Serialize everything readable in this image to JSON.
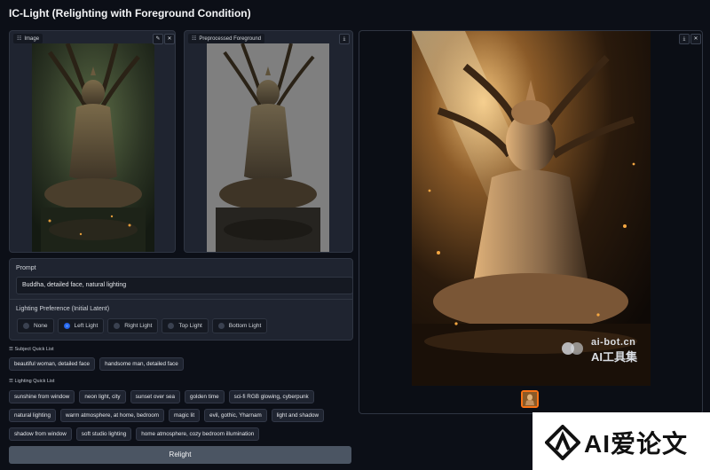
{
  "app": {
    "title": "IC-Light (Relighting with Foreground Condition)"
  },
  "input_panel": {
    "label": "Image",
    "edit_icon": "pencil-icon",
    "close_icon": "close-icon"
  },
  "preprocessed_panel": {
    "label": "Preprocessed Foreground",
    "download_icon": "download-icon"
  },
  "prompt": {
    "label": "Prompt",
    "value": "Buddha, detailed face, natural lighting"
  },
  "lighting": {
    "label": "Lighting Preference (Initial Latent)",
    "options": [
      "None",
      "Left Light",
      "Right Light",
      "Top Light",
      "Bottom Light"
    ],
    "selected": "Left Light"
  },
  "subject_quick_list": {
    "label": "Subject Quick List",
    "items": [
      "beautiful woman, detailed face",
      "handsome man, detailed face"
    ]
  },
  "lighting_quick_list": {
    "label": "Lighting Quick List",
    "items": [
      "sunshine from window",
      "neon light, city",
      "sunset over sea",
      "golden time",
      "sci-fi RGB glowing, cyberpunk",
      "natural lighting",
      "warm atmosphere, at home, bedroom",
      "magic lit",
      "evil, gothic, Yharnam",
      "light and shadow",
      "shadow from window",
      "soft studio lighting",
      "home atmosphere, cozy bedroom illumination"
    ]
  },
  "relight_button": {
    "label": "Relight"
  },
  "result_panel": {
    "download_icon": "download-icon",
    "close_icon": "close-icon"
  },
  "watermark": {
    "line1": "ai-bot.cn",
    "line2": "AI工具集"
  },
  "badge": {
    "text": "AI爱论文"
  },
  "colors": {
    "accent": "#3b82f6",
    "thumb_border": "#f97316",
    "button": "#4b5563",
    "background": "#0c0f17"
  }
}
